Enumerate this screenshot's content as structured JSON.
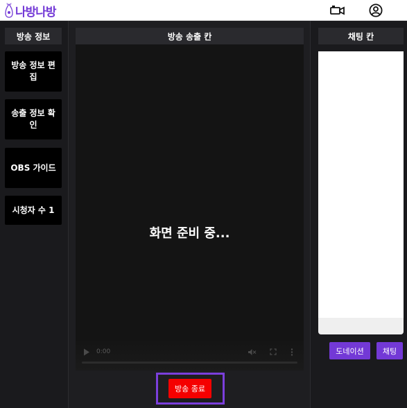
{
  "app": {
    "logo_text": "나방나방"
  },
  "sidebar": {
    "header": "방송 정보",
    "items": [
      {
        "label": "방송 정보 편집"
      },
      {
        "label": "송출 정보 확인"
      },
      {
        "label": "OBS 가이드"
      },
      {
        "label": "시청자 수 1"
      }
    ]
  },
  "stream": {
    "header": "방송 송출 칸",
    "status_text": "화면 준비 중...",
    "video_time": "0:00",
    "end_button": "방송 종료"
  },
  "chat": {
    "header": "채팅 칸",
    "input_placeholder": "",
    "donation_button": "도네이션",
    "send_button": "채팅"
  },
  "colors": {
    "accent": "#7339d6",
    "end_button": "#f50000",
    "highlight_border": "#7b3fdc"
  }
}
